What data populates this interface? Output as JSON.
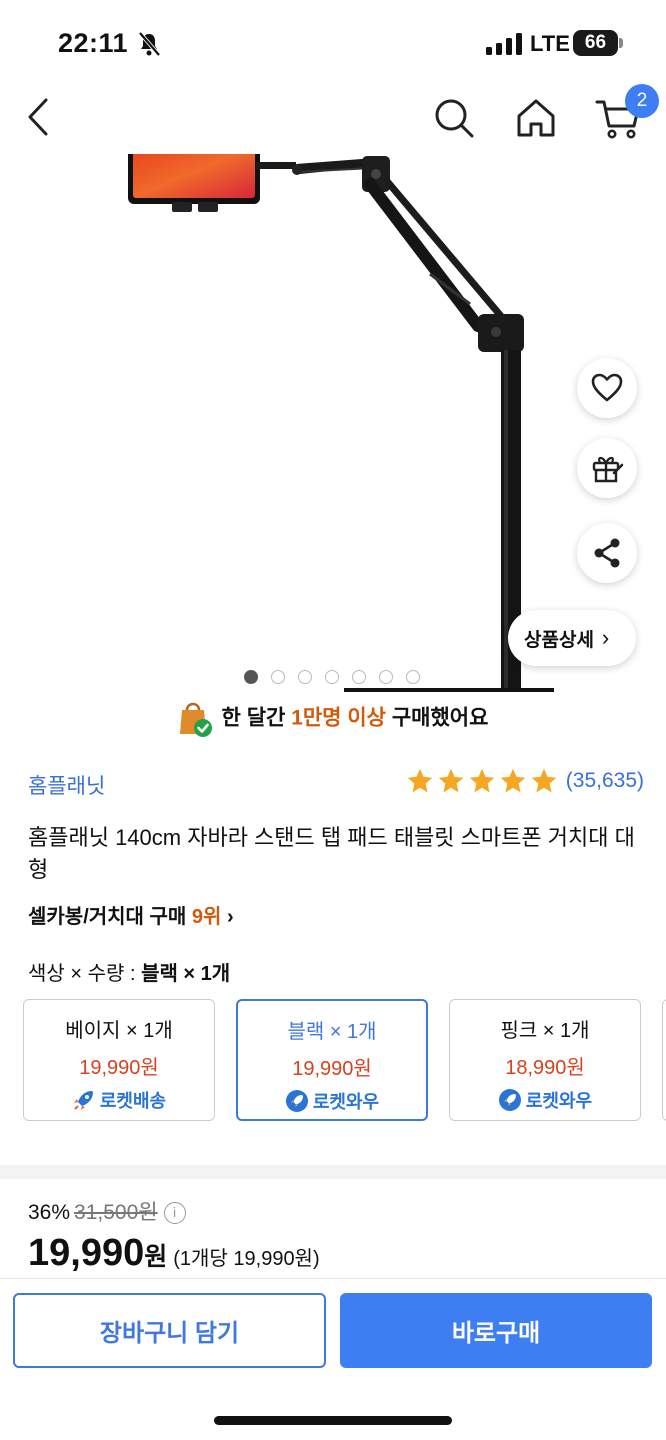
{
  "status_bar": {
    "time": "22:11",
    "network": "LTE",
    "battery": "66"
  },
  "nav": {
    "cart_count": "2",
    "icons": [
      "back-icon",
      "search-icon",
      "home-icon",
      "cart-icon"
    ]
  },
  "image": {
    "page_count": 7,
    "active_page": 1
  },
  "actions": {
    "detail_label": "상품상세",
    "icons": [
      "heart-icon",
      "gift-icon",
      "share-icon"
    ]
  },
  "buyers": {
    "prefix": "한 달간",
    "highlight": "1만명 이상",
    "suffix": "구매했어요"
  },
  "product": {
    "brand": "홈플래닛",
    "rating_stars": 5,
    "review_count": "(35,635)",
    "title": "홈플래닛 140cm 자바라 스탠드 탭 패드 태블릿 스마트폰 거치대 대형",
    "rank_category": "셀카봉/거치대 구매",
    "rank_number": "9위"
  },
  "options": {
    "label_prefix": "색상 × 수량 :",
    "selected_text": "블랙 × 1개",
    "items": [
      {
        "name": "베이지 × 1개",
        "price": "19,990원",
        "shipping": "로켓배송"
      },
      {
        "name": "블랙 × 1개",
        "price": "19,990원",
        "shipping": "로켓와우"
      },
      {
        "name": "핑크 × 1개",
        "price": "18,990원",
        "shipping": "로켓와우"
      }
    ]
  },
  "pricing": {
    "discount": "36%",
    "original": "31,500원",
    "price": "19,990",
    "currency": "원",
    "unit_price": "(1개당 19,990원)"
  },
  "buttons": {
    "add_to_cart": "장바구니 담기",
    "buy_now": "바로구매"
  },
  "colors": {
    "accent": "#3d7ef2",
    "price_red": "#d8421e",
    "highlight_orange": "#d25a0b",
    "star": "#f5a623"
  }
}
